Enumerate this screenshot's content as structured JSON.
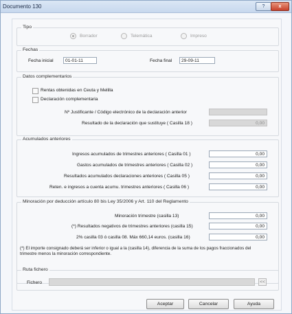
{
  "window": {
    "title": "Documento 130",
    "help_glyph": "?",
    "close_glyph": "x"
  },
  "tipo": {
    "legend": "Tipo",
    "options": [
      {
        "label": "Borrador",
        "selected": true
      },
      {
        "label": "Telemática",
        "selected": false
      },
      {
        "label": "Impreso",
        "selected": false
      }
    ]
  },
  "fechas": {
    "legend": "Fechas",
    "inicial_label": "Fecha inicial",
    "inicial_value": "01-01-11",
    "final_label": "Fecha final",
    "final_value": "29-09-11"
  },
  "complementarios": {
    "legend": "Datos complementarios",
    "check1": "Rentas obtenidas en Ceuta y Melilla",
    "check2": "Declaración complementaria",
    "justificante_label": "Nº Justificante / Código electrónico de la declaración anterior",
    "justificante_value": "",
    "resultado_label": "Resultado de la declaración que sustituye ( Casilla 18 )",
    "resultado_value": "0,00"
  },
  "acumulados": {
    "legend": "Acumulados anteriores",
    "rows": [
      {
        "label": "Ingresos acumulados de trimestres anteriores ( Casilla 01 )",
        "value": "0,00"
      },
      {
        "label": "Gastos acumulados de trimestres anteriores ( Casilla 02 )",
        "value": "0,00"
      },
      {
        "label": "Resultados acumulados declaraciones anteriores ( Casilla 05 )",
        "value": "0,00"
      },
      {
        "label": "Reten. e ingresos a cuenta acumu. trimestres anteriores ( Casilla 06 )",
        "value": "0,00"
      }
    ]
  },
  "minoracion": {
    "legend": "Minoración por deducción artículo 80 bis Ley 35/2006 y Art. 110 del Reglamento",
    "rows": [
      {
        "label": "Minoración trimestre (casilla 13)",
        "value": "0,00"
      },
      {
        "label": "(*) Resultados negativos de trimestres anteriores (casilla 15)",
        "value": "0,00"
      },
      {
        "label": "2% casilla 03 ó casilla 08. Máx 660,14 euros. (casilla 16)",
        "value": "0,00"
      }
    ],
    "note": "(*) El importe consignado deberá ser inferior o igual a la (casilla 14), diferencia de la suma de los pagos fraccionados del trimestre menos la minoración correspondiente."
  },
  "ruta": {
    "legend": "Ruta fichero",
    "fichero_label": "Fichero",
    "fichero_value": "",
    "browse_label": "<<"
  },
  "buttons": {
    "aceptar": "Aceptar",
    "cancelar": "Cancelar",
    "ayuda": "Ayuda"
  }
}
